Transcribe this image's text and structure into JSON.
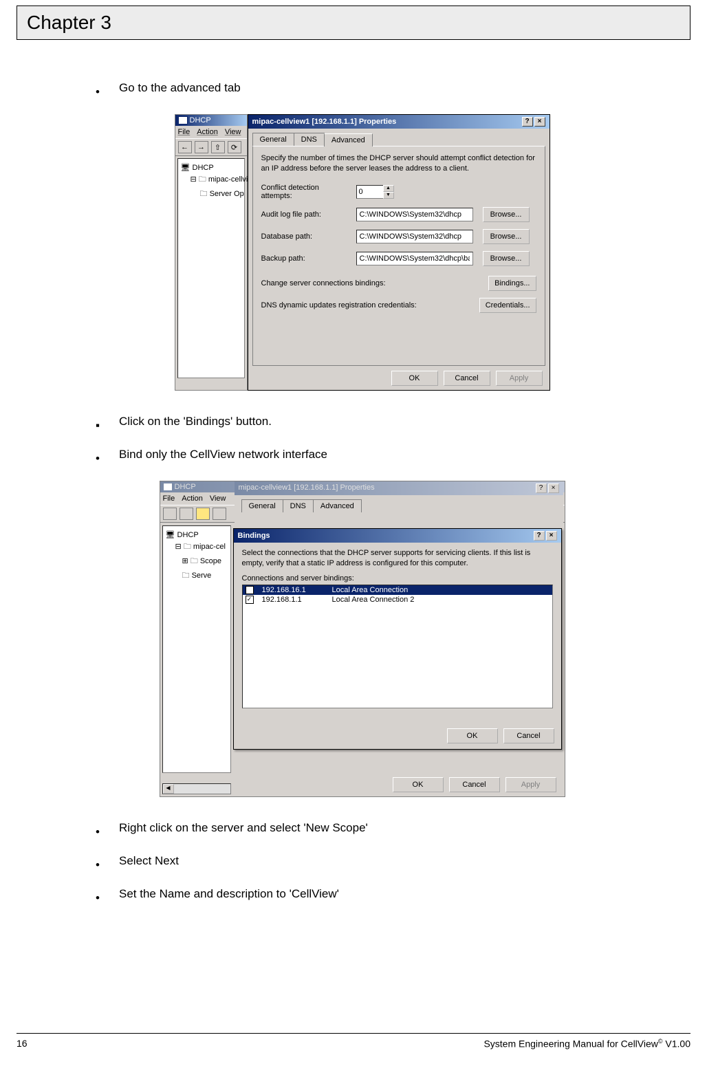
{
  "header": {
    "chapter": "Chapter 3"
  },
  "bullets": [
    "Go to the advanced tab",
    "Click on the 'Bindings' button.",
    "Bind only the CellView network interface",
    "Right click on the server and select 'New Scope'",
    "Select Next",
    "Set the Name and description to 'CellView'"
  ],
  "shot1": {
    "mmc": {
      "title": "DHCP",
      "menus": [
        "File",
        "Action",
        "View"
      ],
      "tree": [
        "DHCP",
        "mipac-cellview",
        "Server Op"
      ]
    },
    "dialog": {
      "title": "mipac-cellview1 [192.168.1.1] Properties",
      "help": "?",
      "close": "×",
      "tabs": [
        "General",
        "DNS",
        "Advanced"
      ],
      "intro": "Specify the number of times the DHCP server should attempt conflict detection for an IP address before the server leases the address to a client.",
      "conflict_label": "Conflict detection attempts:",
      "conflict_value": "0",
      "rows": [
        {
          "label": "Audit log file path:",
          "value": "C:\\WINDOWS\\System32\\dhcp",
          "btn": "Browse..."
        },
        {
          "label": "Database path:",
          "value": "C:\\WINDOWS\\System32\\dhcp",
          "btn": "Browse..."
        },
        {
          "label": "Backup path:",
          "value": "C:\\WINDOWS\\System32\\dhcp\\ba",
          "btn": "Browse..."
        }
      ],
      "bindings_label": "Change server connections bindings:",
      "bindings_btn": "Bindings...",
      "creds_label": "DNS dynamic updates registration credentials:",
      "creds_btn": "Credentials...",
      "footer": {
        "ok": "OK",
        "cancel": "Cancel",
        "apply": "Apply"
      }
    }
  },
  "shot2": {
    "mmc": {
      "title": "DHCP",
      "menus": [
        "File",
        "Action",
        "View"
      ],
      "tree": [
        "DHCP",
        "mipac-cel",
        "Scope",
        "Serve"
      ]
    },
    "backdlg": {
      "title": "mipac-cellview1 [192.168.1.1] Properties",
      "help": "?",
      "close": "×",
      "tabs": [
        "General",
        "DNS",
        "Advanced"
      ],
      "footer": {
        "ok": "OK",
        "cancel": "Cancel",
        "apply": "Apply"
      }
    },
    "bindings": {
      "title": "Bindings",
      "help": "?",
      "close": "×",
      "intro": "Select the connections that the DHCP server supports for servicing clients. If this list is empty, verify that a static IP address is configured for this computer.",
      "list_label": "Connections and server bindings:",
      "rows": [
        {
          "checked": false,
          "ip": "192.168.16.1",
          "name": "Local Area Connection"
        },
        {
          "checked": true,
          "ip": "192.168.1.1",
          "name": "Local Area Connection 2"
        }
      ],
      "footer": {
        "ok": "OK",
        "cancel": "Cancel"
      }
    }
  },
  "footer": {
    "page": "16",
    "doc_title_pre": "System Engineering Manual for CellView",
    "doc_title_sup": "©",
    "doc_title_post": " V1.00"
  }
}
